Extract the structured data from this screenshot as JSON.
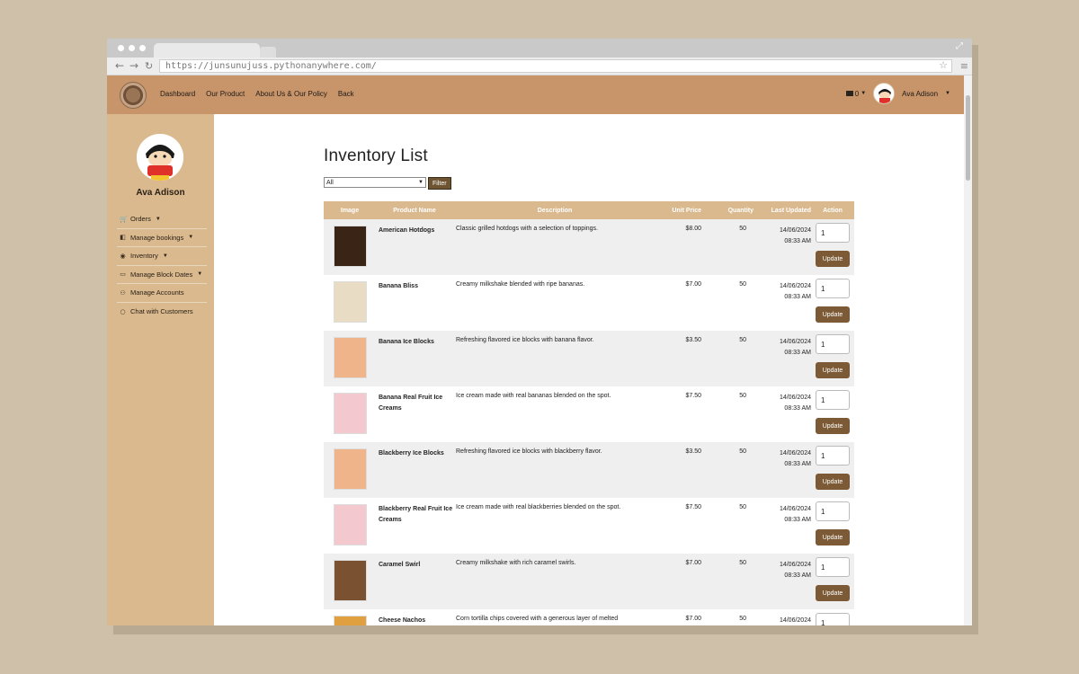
{
  "browser": {
    "url": "https://junsunujuss.pythonanywhere.com/"
  },
  "nav": {
    "links": [
      "Dashboard",
      "Our Product",
      "About Us & Our Policy",
      "Back"
    ],
    "mail_count": "0",
    "user": "Ava Adison"
  },
  "sidebar": {
    "name": "Ava Adison",
    "items": [
      {
        "label": "Orders",
        "icon": "cart-icon",
        "caret": true
      },
      {
        "label": "Manage bookings",
        "icon": "book-icon",
        "caret": true
      },
      {
        "label": "Inventory",
        "icon": "eye-icon",
        "caret": true
      },
      {
        "label": "Manage Block Dates",
        "icon": "open-book-icon",
        "caret": true
      },
      {
        "label": "Manage Accounts",
        "icon": "users-icon",
        "caret": false
      },
      {
        "label": "Chat with Customers",
        "icon": "chat-icon",
        "caret": false
      }
    ]
  },
  "page": {
    "title": "Inventory List",
    "filter_value": "All",
    "filter_button": "Filter"
  },
  "table": {
    "headers": [
      "Image",
      "Product Name",
      "Description",
      "Unit Price",
      "Quantity",
      "Last Updated",
      "Action"
    ],
    "update_label": "Update",
    "rows": [
      {
        "name": "American Hotdogs",
        "description": "Classic grilled hotdogs with a selection of toppings.",
        "price": "$8.00",
        "quantity": "50",
        "date": "14/06/2024",
        "time": "08:33 AM",
        "qty_input": "1",
        "thumb_color": "#3a2416"
      },
      {
        "name": "Banana Bliss",
        "description": "Creamy milkshake blended with ripe bananas.",
        "price": "$7.00",
        "quantity": "50",
        "date": "14/06/2024",
        "time": "08:33 AM",
        "qty_input": "1",
        "thumb_color": "#e8dcc4"
      },
      {
        "name": "Banana Ice Blocks",
        "description": "Refreshing flavored ice blocks with banana flavor.",
        "price": "$3.50",
        "quantity": "50",
        "date": "14/06/2024",
        "time": "08:33 AM",
        "qty_input": "1",
        "thumb_color": "#f0b48a"
      },
      {
        "name": "Banana Real Fruit Ice Creams",
        "description": "Ice cream made with real bananas blended on the spot.",
        "price": "$7.50",
        "quantity": "50",
        "date": "14/06/2024",
        "time": "08:33 AM",
        "qty_input": "1",
        "thumb_color": "#f3c9cf"
      },
      {
        "name": "Blackberry Ice Blocks",
        "description": "Refreshing flavored ice blocks with blackberry flavor.",
        "price": "$3.50",
        "quantity": "50",
        "date": "14/06/2024",
        "time": "08:33 AM",
        "qty_input": "1",
        "thumb_color": "#f0b48a"
      },
      {
        "name": "Blackberry Real Fruit Ice Creams",
        "description": "Ice cream made with real blackberries blended on the spot.",
        "price": "$7.50",
        "quantity": "50",
        "date": "14/06/2024",
        "time": "08:33 AM",
        "qty_input": "1",
        "thumb_color": "#f3c9cf"
      },
      {
        "name": "Caramel Swirl",
        "description": "Creamy milkshake with rich caramel swirls.",
        "price": "$7.00",
        "quantity": "50",
        "date": "14/06/2024",
        "time": "08:33 AM",
        "qty_input": "1",
        "thumb_color": "#7a5232"
      },
      {
        "name": "Cheese Nachos",
        "description": "Corn tortilla chips covered with a generous layer of melted",
        "price": "$7.00",
        "quantity": "50",
        "date": "14/06/2024",
        "time": "",
        "qty_input": "1",
        "thumb_color": "#e0a040"
      }
    ]
  }
}
